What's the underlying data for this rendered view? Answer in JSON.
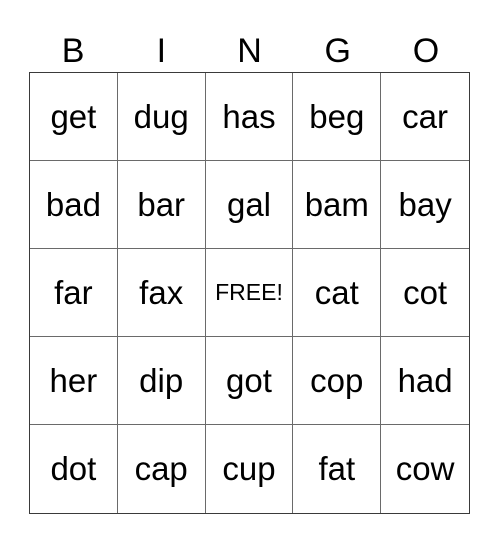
{
  "header": [
    "B",
    "I",
    "N",
    "G",
    "O"
  ],
  "rows": [
    [
      "get",
      "dug",
      "has",
      "beg",
      "car"
    ],
    [
      "bad",
      "bar",
      "gal",
      "bam",
      "bay"
    ],
    [
      "far",
      "fax",
      "FREE!",
      "cat",
      "cot"
    ],
    [
      "her",
      "dip",
      "got",
      "cop",
      "had"
    ],
    [
      "dot",
      "cap",
      "cup",
      "fat",
      "cow"
    ]
  ],
  "free_label": "FREE!"
}
